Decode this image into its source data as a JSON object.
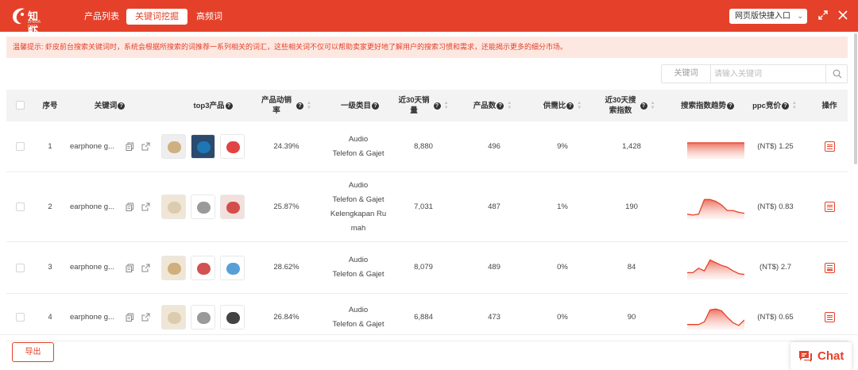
{
  "app": {
    "logo_text": "知虾",
    "logo_sub": "ZHIXIA DATA"
  },
  "nav": {
    "tabs": [
      {
        "label": "产品列表",
        "active": false
      },
      {
        "label": "关键词挖掘",
        "active": true
      },
      {
        "label": "高频词",
        "active": false
      }
    ]
  },
  "toolbar": {
    "quick_entry": "网页版快捷入口",
    "expand_icon": "expand-icon",
    "close_icon": "close-icon"
  },
  "notice": {
    "text": "温馨提示: 虾皮前台搜索关键词时，系统会根据所搜索的词推荐一系列相关的词汇，这些相关词不仅可以帮助卖家更好地了解用户的搜索习惯和需求，还能揭示更多的细分市场。"
  },
  "search": {
    "field_label": "关键词",
    "placeholder": "请输入关键词",
    "value": ""
  },
  "table": {
    "headers": {
      "index": "序号",
      "keyword": "关键词",
      "top3": "top3产品",
      "sell_rate_1": "产品动销",
      "sell_rate_2": "率",
      "category": "一级类目",
      "sales30_1": "近30天销",
      "sales30_2": "量",
      "products": "产品数",
      "supply": "供需比",
      "search30_1": "近30天搜",
      "search30_2": "索指数",
      "trend": "搜索指数趋势",
      "ppc": "ppc竞价",
      "action": "操作"
    },
    "rows": [
      {
        "index": "1",
        "keyword": "earphone g...",
        "sell_rate": "24.39%",
        "category": "Audio\nTelefon & Gajet",
        "sales30": "8,880",
        "products": "496",
        "supply": "9%",
        "search30": "1,428",
        "ppc": "(NT$) 1.25",
        "trend": [
          0.7,
          0.7,
          0.7,
          0.7,
          0.7,
          0.7,
          0.7,
          0.7,
          0.7,
          0.7,
          0.7
        ]
      },
      {
        "index": "2",
        "keyword": "earphone g...",
        "sell_rate": "25.87%",
        "category": "Audio\nTelefon & Gajet\nKelengkapan Ru\nmah",
        "sales30": "7,031",
        "products": "487",
        "supply": "1%",
        "search30": "190",
        "ppc": "(NT$) 0.83",
        "trend": [
          0.1,
          0.05,
          0.1,
          0.9,
          0.9,
          0.8,
          0.6,
          0.3,
          0.3,
          0.2,
          0.15
        ]
      },
      {
        "index": "3",
        "keyword": "earphone g...",
        "sell_rate": "28.62%",
        "category": "Audio\nTelefon & Gajet",
        "sales30": "8,079",
        "products": "489",
        "supply": "0%",
        "search30": "84",
        "ppc": "(NT$) 2.7",
        "trend": [
          0.2,
          0.2,
          0.45,
          0.3,
          0.9,
          0.75,
          0.6,
          0.5,
          0.3,
          0.15,
          0.1
        ]
      },
      {
        "index": "4",
        "keyword": "earphone g...",
        "sell_rate": "26.84%",
        "category": "Audio\nTelefon & Gajet",
        "sales30": "6,884",
        "products": "473",
        "supply": "0%",
        "search30": "90",
        "ppc": "(NT$) 0.65",
        "trend": [
          0.1,
          0.1,
          0.1,
          0.25,
          0.9,
          0.95,
          0.85,
          0.5,
          0.2,
          0.05,
          0.35
        ]
      }
    ]
  },
  "footer": {
    "export_label": "导出",
    "chat_label": "Chat"
  },
  "colors": {
    "brand": "#e5412a",
    "trend_fill": "#f6b8ab"
  }
}
